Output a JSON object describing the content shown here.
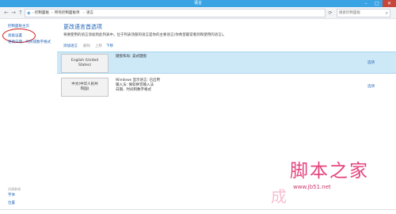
{
  "window": {
    "title": "语言"
  },
  "address_bar": {
    "breadcrumbs": [
      "控制面板",
      "所有控制面板项",
      "语言"
    ],
    "search_placeholder": "搜索控制面板"
  },
  "left_nav": {
    "items": [
      "控制面板主页",
      "高级设置",
      "更改日期、时间或数字格式"
    ],
    "see_also_label": "另请参阅",
    "see_also_items": [
      "字体",
      "位置"
    ]
  },
  "main": {
    "heading": "更改语言首选项",
    "description": "将要使用的语言添加到此列表中。位于列表顶部的语言是你的主要语言(你希望最常看到和使用的语言)。",
    "toolbar": {
      "add": "添加语言",
      "remove": "删除",
      "up": "上移",
      "down": "下移"
    },
    "languages": [
      {
        "name_lines": [
          "English (United",
          "States)"
        ],
        "info": [
          "键盘布局: 美式键盘"
        ],
        "options": "选项"
      },
      {
        "name_lines": [
          "中文(中华人民共",
          "和国)"
        ],
        "info": [
          "Windows 显示语言: 已启用",
          "输入法: 微软拼音输入法",
          "日期、时间和数字格式"
        ],
        "options": "选项"
      }
    ]
  },
  "watermark": {
    "text_cn": "脚本之家",
    "url": "www.jb51.net",
    "mark": "成"
  },
  "colors": {
    "titlebar": "#3aa3e3",
    "link": "#1a5fb4",
    "selected_row": "#cde8f7",
    "annotation_circle": "#d21f1f",
    "watermark": "#e4447e"
  }
}
